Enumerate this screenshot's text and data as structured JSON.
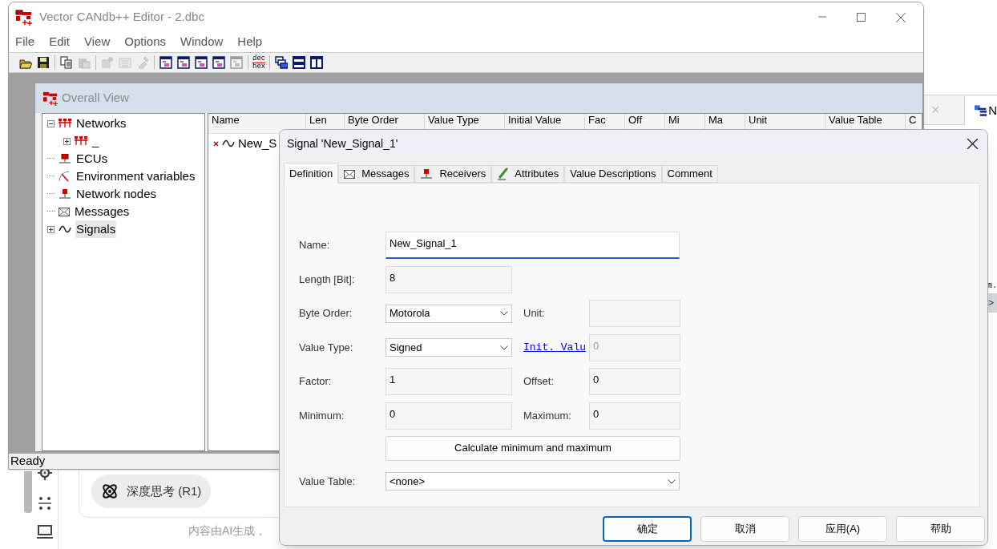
{
  "background": {
    "tab_close": "×",
    "tab_label": "N",
    "side_text": "m.",
    "side_arrow": ">",
    "pill": "深度思考 (R1)",
    "disclaimer": "内容由AI生成，"
  },
  "main_window": {
    "title": "Vector CANdb++ Editor - 2.dbc",
    "menu": [
      "File",
      "Edit",
      "View",
      "Options",
      "Window",
      "Help"
    ],
    "toolbar": [
      {
        "kind": "open",
        "disabled": false
      },
      {
        "kind": "save",
        "disabled": false
      },
      {
        "kind": "separator"
      },
      {
        "kind": "copy",
        "disabled": false
      },
      {
        "kind": "paste",
        "disabled": true
      },
      {
        "kind": "separator"
      },
      {
        "kind": "properties",
        "disabled": true
      },
      {
        "kind": "form",
        "disabled": true
      },
      {
        "kind": "tool",
        "disabled": true
      },
      {
        "kind": "separator"
      },
      {
        "kind": "window",
        "disabled": false
      },
      {
        "kind": "window",
        "disabled": false
      },
      {
        "kind": "window",
        "disabled": false
      },
      {
        "kind": "window",
        "disabled": false
      },
      {
        "kind": "window",
        "disabled": true
      },
      {
        "kind": "separator"
      },
      {
        "kind": "dechex",
        "top": "dec",
        "bottom": "hex",
        "disabled": false
      },
      {
        "kind": "separator"
      },
      {
        "kind": "cascade",
        "disabled": false
      },
      {
        "kind": "tile-horizontal",
        "disabled": false
      },
      {
        "kind": "tile-vertical",
        "disabled": false
      }
    ],
    "status_bar": "Ready"
  },
  "overall_view": {
    "title": "Overall View",
    "tree": [
      {
        "label": "Networks",
        "kind": "network",
        "expandable": true,
        "expanded": true,
        "selected": false,
        "children": [
          {
            "label": "_",
            "kind": "network",
            "expandable": true,
            "expanded": false,
            "selected": false
          }
        ]
      },
      {
        "label": "ECUs",
        "kind": "ecu",
        "expandable": false,
        "selected": false
      },
      {
        "label": "Environment variables",
        "kind": "envvar",
        "expandable": false,
        "selected": false
      },
      {
        "label": "Network nodes",
        "kind": "node",
        "expandable": false,
        "selected": false
      },
      {
        "label": "Messages",
        "kind": "message",
        "expandable": false,
        "selected": false
      },
      {
        "label": "Signals",
        "kind": "signal",
        "expandable": true,
        "expanded": false,
        "selected": true
      }
    ],
    "columns": [
      "Name",
      "Len",
      "Byte Order",
      "Value Type",
      "Initial Value",
      "Fac",
      "Off",
      "Mi",
      "Ma",
      "Unit",
      "Value Table",
      "C"
    ],
    "rows": [
      {
        "name": "New_S"
      }
    ]
  },
  "dialog": {
    "title": "Signal 'New_Signal_1'",
    "tabs": [
      {
        "label": "Definition",
        "kind": "plain",
        "selected": true
      },
      {
        "label": "Messages",
        "kind": "message",
        "selected": false
      },
      {
        "label": "Receivers",
        "kind": "node",
        "selected": false
      },
      {
        "label": "Attributes",
        "kind": "pencil",
        "selected": false
      },
      {
        "label": "Value Descriptions",
        "kind": "plain",
        "selected": false
      },
      {
        "label": "Comment",
        "kind": "plain",
        "selected": false
      }
    ],
    "form": [
      {
        "kind": "text",
        "label": "Name:",
        "value": "New_Signal_1",
        "wide": true,
        "focused": true
      },
      {
        "kind": "text",
        "label": "Length [Bit]:",
        "value": "8",
        "wide": false,
        "focused": false
      },
      {
        "kind": "dropdown",
        "label": "Byte Order:",
        "value": "Motorola",
        "wide": false,
        "focused": false,
        "side": {
          "kind": "label",
          "label": "Unit:"
        }
      },
      {
        "kind": "dropdown",
        "label": "Value Type:",
        "value": "Signed",
        "wide": false,
        "focused": false,
        "side": {
          "kind": "link",
          "label": "Init. Valu",
          "value": "0",
          "disabled": true
        }
      },
      {
        "kind": "text",
        "label": "Factor:",
        "value": "1",
        "wide": false,
        "focused": false,
        "side": {
          "kind": "label",
          "label": "Offset:",
          "value": "0"
        }
      },
      {
        "kind": "text",
        "label": "Minimum:",
        "value": "0",
        "wide": false,
        "focused": false,
        "side": {
          "kind": "label",
          "label": "Maximum:",
          "value": "0"
        }
      },
      {
        "kind": "button",
        "label": "Calculate minimum and maximum"
      },
      {
        "kind": "dropdown",
        "label": "Value Table:",
        "value": "<none>",
        "wide": true,
        "focused": false
      }
    ],
    "buttons": [
      {
        "label": "确定",
        "default": true
      },
      {
        "label": "取消",
        "default": false
      },
      {
        "label": "应用(A)",
        "default": false
      },
      {
        "label": "帮助",
        "default": false
      }
    ]
  }
}
